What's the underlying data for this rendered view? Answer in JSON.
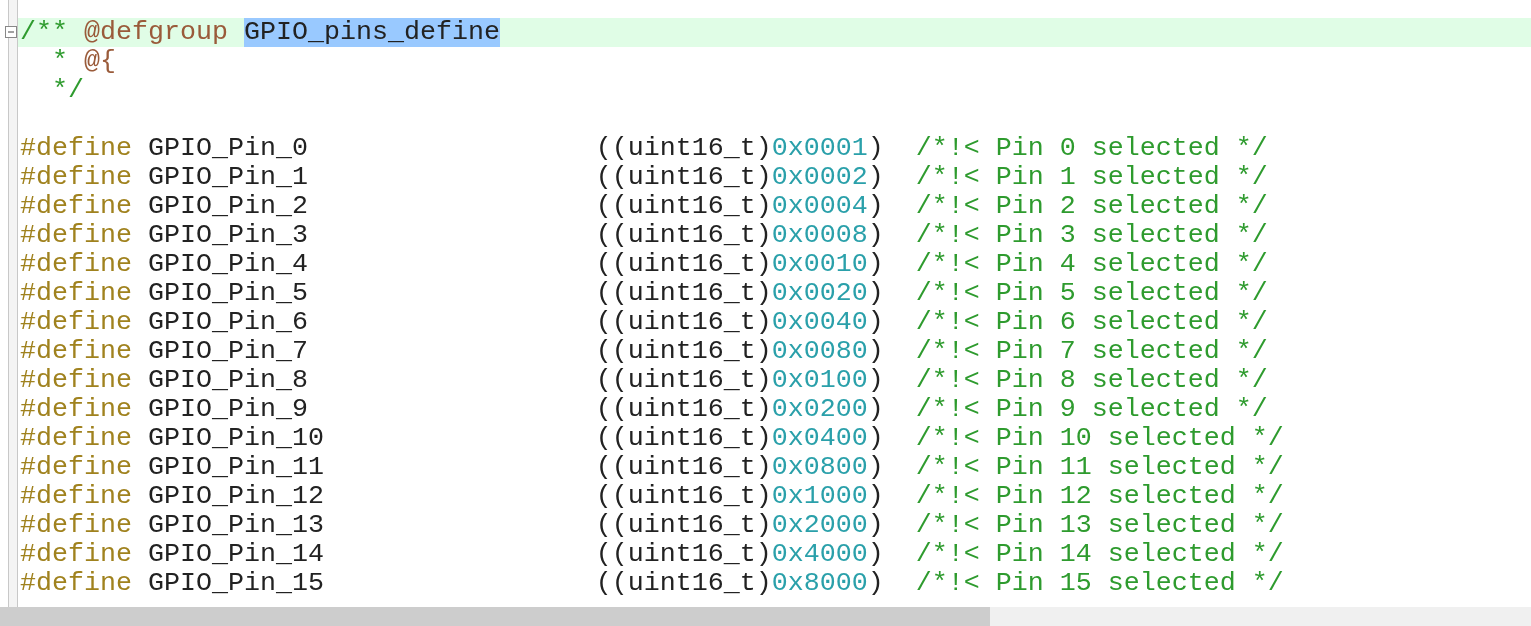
{
  "header_lines": [
    {
      "kind": "open",
      "current": true,
      "foldable": true,
      "mark": "/**",
      "tag": "@defgroup",
      "selection": "GPIO_pins_define"
    },
    {
      "kind": "continuation",
      "current": false,
      "foldable": false,
      "mark": "*",
      "tag": "@{"
    },
    {
      "kind": "continuation",
      "current": false,
      "foldable": false,
      "mark": "*/"
    }
  ],
  "defines": [
    {
      "keyword": "#define",
      "name": "GPIO_Pin_0",
      "cast": "((uint16_t)",
      "value": "0x0001",
      "close": ")",
      "comment": "/*!< Pin 0 selected */"
    },
    {
      "keyword": "#define",
      "name": "GPIO_Pin_1",
      "cast": "((uint16_t)",
      "value": "0x0002",
      "close": ")",
      "comment": "/*!< Pin 1 selected */"
    },
    {
      "keyword": "#define",
      "name": "GPIO_Pin_2",
      "cast": "((uint16_t)",
      "value": "0x0004",
      "close": ")",
      "comment": "/*!< Pin 2 selected */"
    },
    {
      "keyword": "#define",
      "name": "GPIO_Pin_3",
      "cast": "((uint16_t)",
      "value": "0x0008",
      "close": ")",
      "comment": "/*!< Pin 3 selected */"
    },
    {
      "keyword": "#define",
      "name": "GPIO_Pin_4",
      "cast": "((uint16_t)",
      "value": "0x0010",
      "close": ")",
      "comment": "/*!< Pin 4 selected */"
    },
    {
      "keyword": "#define",
      "name": "GPIO_Pin_5",
      "cast": "((uint16_t)",
      "value": "0x0020",
      "close": ")",
      "comment": "/*!< Pin 5 selected */"
    },
    {
      "keyword": "#define",
      "name": "GPIO_Pin_6",
      "cast": "((uint16_t)",
      "value": "0x0040",
      "close": ")",
      "comment": "/*!< Pin 6 selected */"
    },
    {
      "keyword": "#define",
      "name": "GPIO_Pin_7",
      "cast": "((uint16_t)",
      "value": "0x0080",
      "close": ")",
      "comment": "/*!< Pin 7 selected */"
    },
    {
      "keyword": "#define",
      "name": "GPIO_Pin_8",
      "cast": "((uint16_t)",
      "value": "0x0100",
      "close": ")",
      "comment": "/*!< Pin 8 selected */"
    },
    {
      "keyword": "#define",
      "name": "GPIO_Pin_9",
      "cast": "((uint16_t)",
      "value": "0x0200",
      "close": ")",
      "comment": "/*!< Pin 9 selected */"
    },
    {
      "keyword": "#define",
      "name": "GPIO_Pin_10",
      "cast": "((uint16_t)",
      "value": "0x0400",
      "close": ")",
      "comment": "/*!< Pin 10 selected */"
    },
    {
      "keyword": "#define",
      "name": "GPIO_Pin_11",
      "cast": "((uint16_t)",
      "value": "0x0800",
      "close": ")",
      "comment": "/*!< Pin 11 selected */"
    },
    {
      "keyword": "#define",
      "name": "GPIO_Pin_12",
      "cast": "((uint16_t)",
      "value": "0x1000",
      "close": ")",
      "comment": "/*!< Pin 12 selected */"
    },
    {
      "keyword": "#define",
      "name": "GPIO_Pin_13",
      "cast": "((uint16_t)",
      "value": "0x2000",
      "close": ")",
      "comment": "/*!< Pin 13 selected */"
    },
    {
      "keyword": "#define",
      "name": "GPIO_Pin_14",
      "cast": "((uint16_t)",
      "value": "0x4000",
      "close": ")",
      "comment": "/*!< Pin 14 selected */"
    },
    {
      "keyword": "#define",
      "name": "GPIO_Pin_15",
      "cast": "((uint16_t)",
      "value": "0x8000",
      "close": ")",
      "comment": "/*!< Pin 15 selected */"
    }
  ]
}
